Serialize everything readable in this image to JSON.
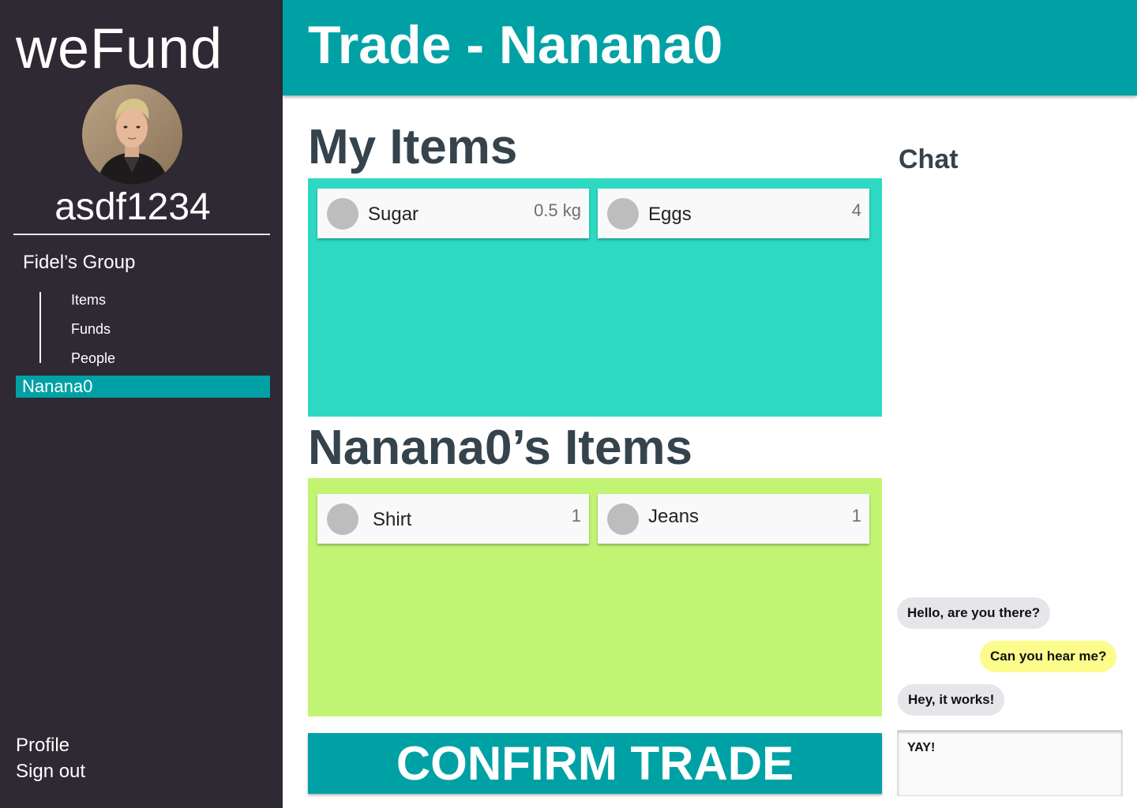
{
  "sidebar": {
    "brand": "weFund",
    "avatar_icon": "user-photo-icon",
    "username": "asdf1234",
    "group_title": "Fidel’s Group",
    "group_items": [
      "Items",
      "Funds",
      "People"
    ],
    "active_item": "Nanana0",
    "profile_link": "Profile",
    "signout_link": "Sign out"
  },
  "header": {
    "title": "Trade - Nanana0"
  },
  "my_items": {
    "title": "My Items",
    "items": [
      {
        "name": "Sugar",
        "qty": "0.5 kg"
      },
      {
        "name": "Eggs",
        "qty": "4"
      }
    ]
  },
  "their_items": {
    "title": "Nanana0’s Items",
    "items": [
      {
        "name": "Shirt",
        "qty": "1"
      },
      {
        "name": "Jeans",
        "qty": "1"
      }
    ]
  },
  "confirm_label": "CONFIRM TRADE",
  "chat": {
    "title": "Chat",
    "messages": [
      {
        "text": "Hello, are you there?",
        "from": "them"
      },
      {
        "text": "Can you hear me?",
        "from": "me"
      },
      {
        "text": "Hey, it works!",
        "from": "them"
      }
    ],
    "input_value": "YAY!"
  },
  "colors": {
    "sidebar_bg": "#2e2933",
    "accent": "#00a1a5",
    "my_items_bg": "#2dd9c3",
    "their_items_bg": "#c2f474",
    "my_bubble": "#fcfc8c",
    "their_bubble": "#e6e6ea",
    "heading_text": "#35434c"
  }
}
